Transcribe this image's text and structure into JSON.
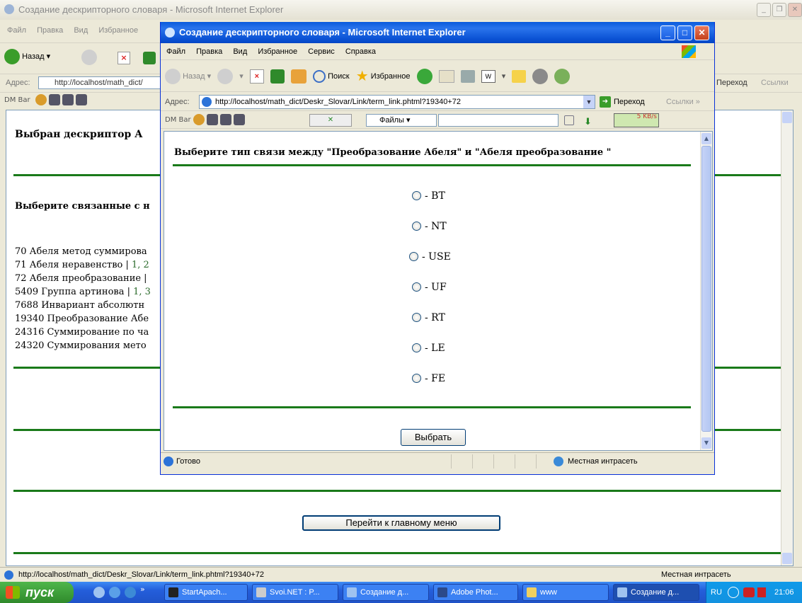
{
  "bg_window": {
    "title": "Создание дескрипторного словаря - Microsoft Internet Explorer",
    "menu": [
      "Файл",
      "Правка",
      "Вид",
      "Избранное"
    ],
    "back_label": "Назад",
    "address_label": "Адрес:",
    "address_value": "http://localhost/math_dict/",
    "go_label": "Переход",
    "links_label": "Ссылки",
    "dmbar_label": "DM Bar",
    "heading": "Выбран дескриптор А",
    "subheading": "Выберите связанные с н",
    "list": [
      {
        "text": "70 Абеля метод суммирова",
        "links": ""
      },
      {
        "text": "71 Абеля неравенство | ",
        "links": "1, 2"
      },
      {
        "text": "72 Абеля преобразование |",
        "links": ""
      },
      {
        "text": "5409 Группа артинова | ",
        "links": "1, 3"
      },
      {
        "text": "7688 Инвариант абсолютн",
        "links": ""
      },
      {
        "text": "19340 Преобразование Абе",
        "links": ""
      },
      {
        "text": "24316 Суммирование по ча",
        "links": ""
      },
      {
        "text": "24320 Суммирования мето",
        "links": ""
      }
    ],
    "main_menu_button": "Перейти к главному меню",
    "status_url": "http://localhost/math_dict/Deskr_Slovar/Link/term_link.phtml?19340+72",
    "status_zone": "Местная интрасеть"
  },
  "popup": {
    "title": "Создание дескрипторного словаря - Microsoft Internet Explorer",
    "menu": [
      "Файл",
      "Правка",
      "Вид",
      "Избранное",
      "Сервис",
      "Справка"
    ],
    "back_label": "Назад",
    "search_label": "Поиск",
    "favorites_label": "Избранное",
    "address_label": "Адрес:",
    "address_value": "http://localhost/math_dict/Deskr_Slovar/Link/term_link.phtml?19340+72",
    "go_label": "Переход",
    "links_label": "Ссылки",
    "dmbar_label": "DM Bar",
    "files_label": "Файлы",
    "speed": "5 KB/s",
    "question": "Выберите тип связи между \"Преобразование Абеля\" и \"Абеля преобразование \"",
    "options": [
      "- BT",
      "- NT",
      "- USE",
      "- UF",
      "- RT",
      "- LE",
      "- FE"
    ],
    "choose_button": "Выбрать",
    "status_text": "Готово",
    "status_zone": "Местная интрасеть"
  },
  "taskbar": {
    "start_label": "пуск",
    "tasks": [
      "StartApach...",
      "Svoi.NET : P...",
      "Создание д...",
      "Adobe Phot...",
      "www",
      "Создание д..."
    ],
    "lang": "RU",
    "clock": "21:06"
  },
  "colors": {
    "rule_green": "#1a7a1a",
    "xp_title_blue": "#0a5bdc",
    "taskbar_blue": "#245edb",
    "start_green": "#2f8a2b"
  }
}
